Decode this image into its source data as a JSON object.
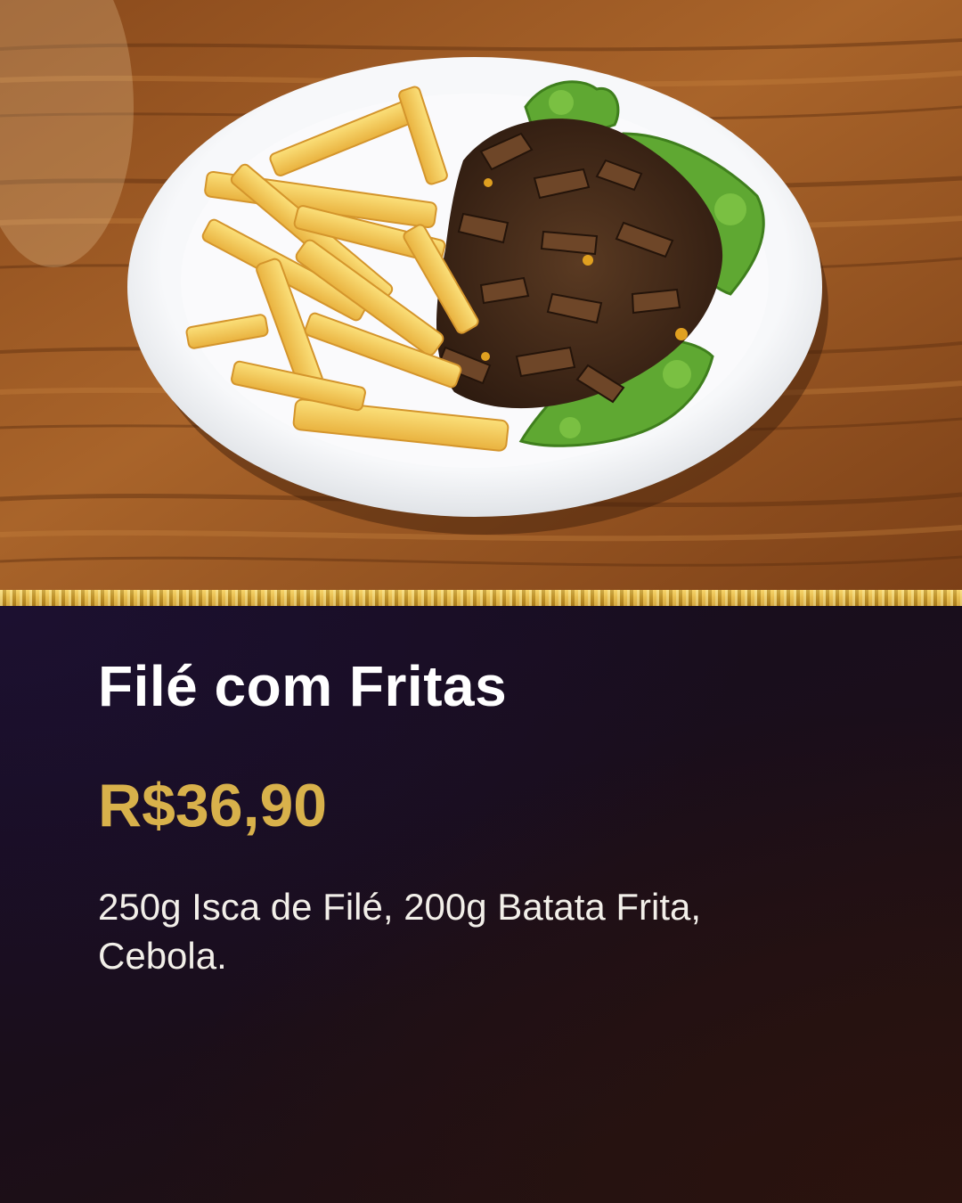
{
  "product": {
    "name": "Filé com Fritas",
    "price": "R$36,90",
    "description": "250g Isca de Filé, 200g Batata Frita, Cebola."
  },
  "colors": {
    "panel_background": "#1a0d1f",
    "price_gold": "#d8b14b",
    "title_text": "#ffffff",
    "border_gold": "#d9aa36"
  },
  "photo": {
    "icon": "dish-photo",
    "subject": "plate of steak strips with french fries and lettuce on a wooden table"
  }
}
